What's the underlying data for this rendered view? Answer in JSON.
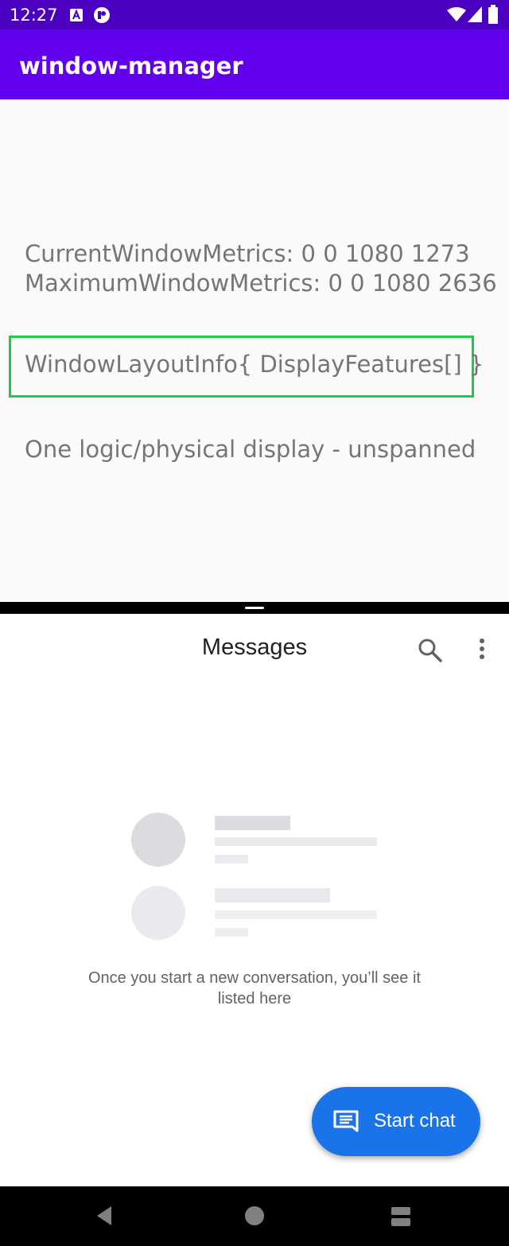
{
  "status_bar": {
    "time": "12:27"
  },
  "app_bar": {
    "title": "window-manager"
  },
  "window_info": {
    "current_metrics": "CurrentWindowMetrics: 0 0 1080 1273",
    "maximum_metrics": "MaximumWindowMetrics: 0 0 1080 2636",
    "layout_info": "WindowLayoutInfo{ DisplayFeatures[] }",
    "display_state": "One logic/physical display - unspanned",
    "highlight_color": "#1fca4b"
  },
  "messages": {
    "title": "Messages",
    "empty_line1": "Once you start a new conversation, you’ll see it",
    "empty_line2": "listed here",
    "fab_label": "Start chat",
    "accent": "#1a73e8"
  },
  "icons": {
    "status": [
      "a-icon",
      "vpn-icon",
      "wifi-icon",
      "signal-icon",
      "battery-icon"
    ],
    "messages": [
      "search-icon",
      "more-vert-icon",
      "chat-icon"
    ],
    "nav": [
      "back-icon",
      "home-icon",
      "recents-icon"
    ]
  }
}
